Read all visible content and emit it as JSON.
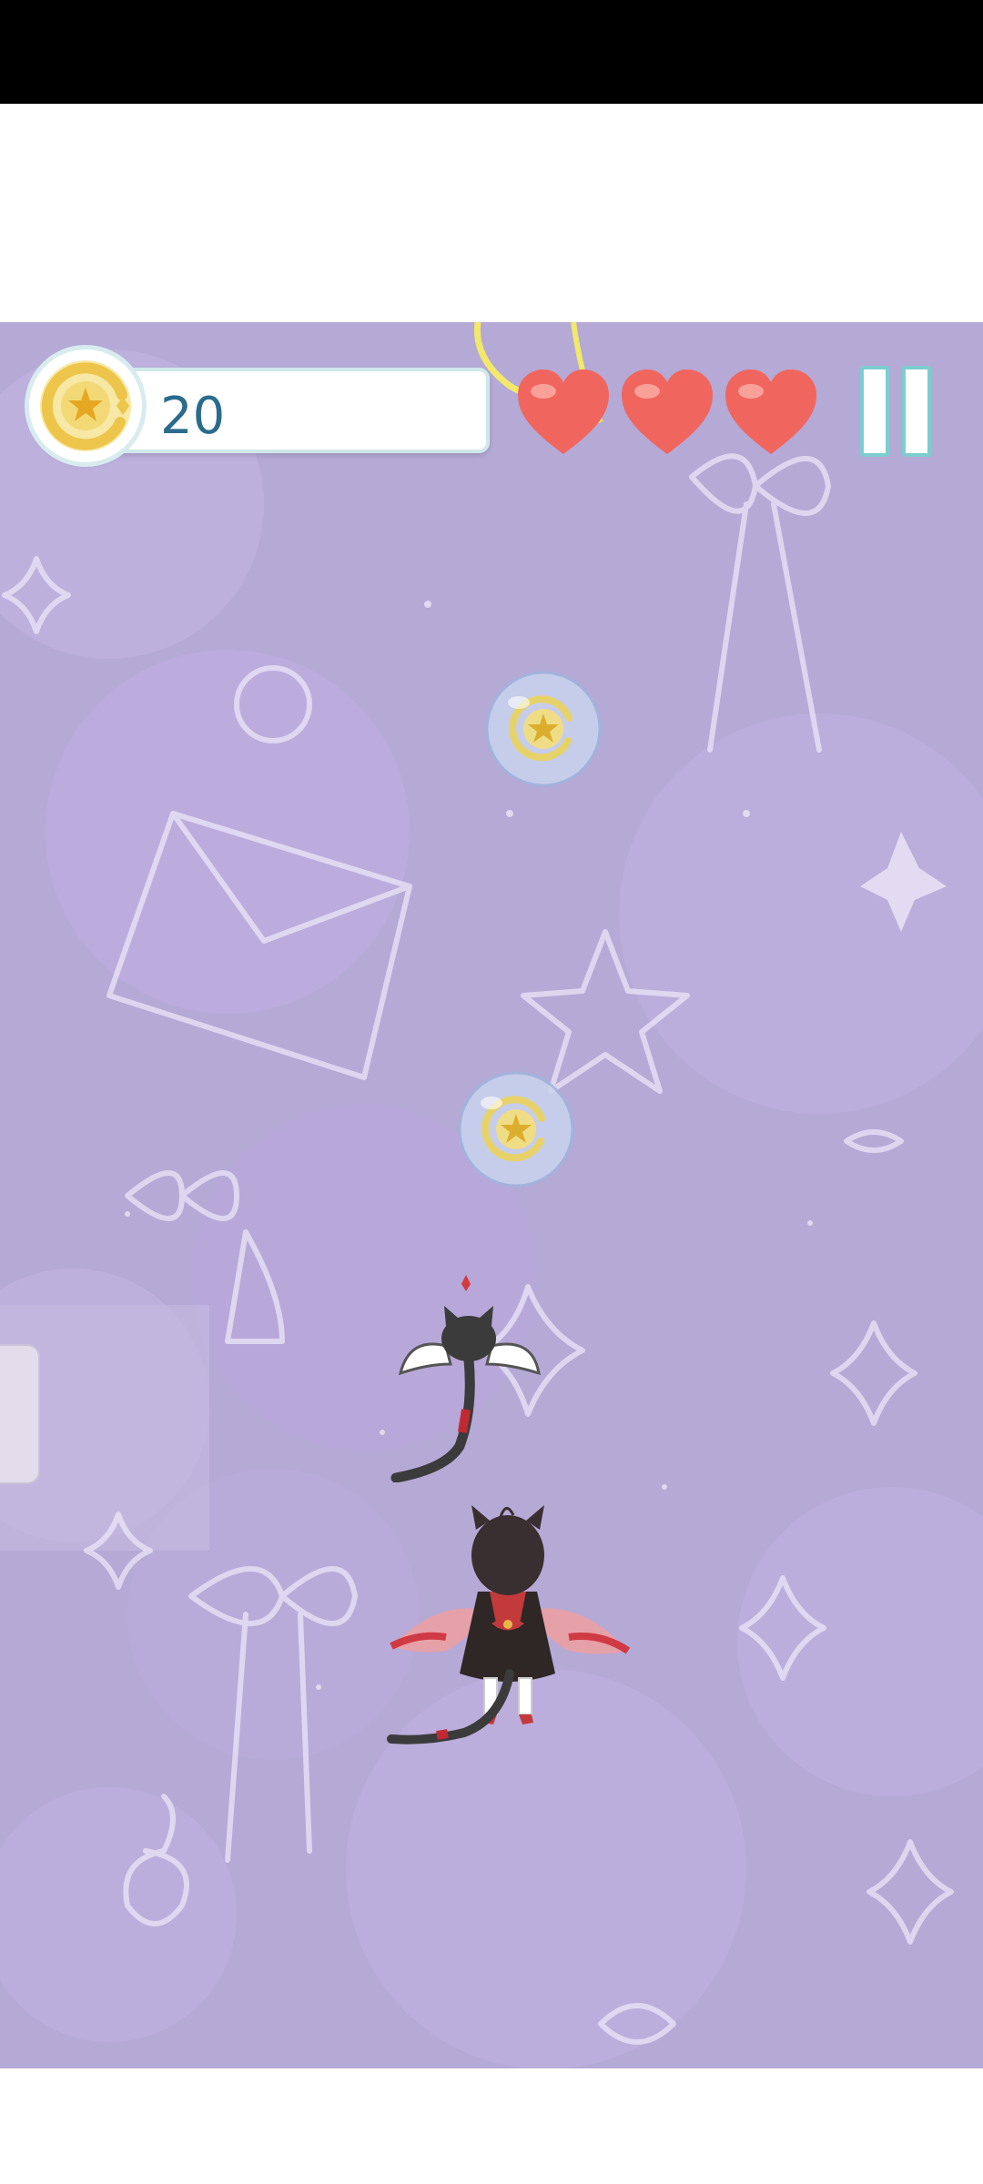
{
  "hud": {
    "coin_count": "20",
    "lives": 3,
    "coin_icon": "star-coin-icon",
    "heart_icon": "heart-icon",
    "pause_icon": "pause-icon"
  },
  "colors": {
    "background": "#b5a9d6",
    "heart": "#f0665f",
    "coin_gold": "#f1cf58",
    "hud_text": "#2b6b8c",
    "pause_border": "#7ccdd0"
  },
  "game_objects": {
    "coin_bubbles": 2,
    "player": "winged-cat-girl-sprite",
    "companion": "winged-black-cat-sprite"
  }
}
